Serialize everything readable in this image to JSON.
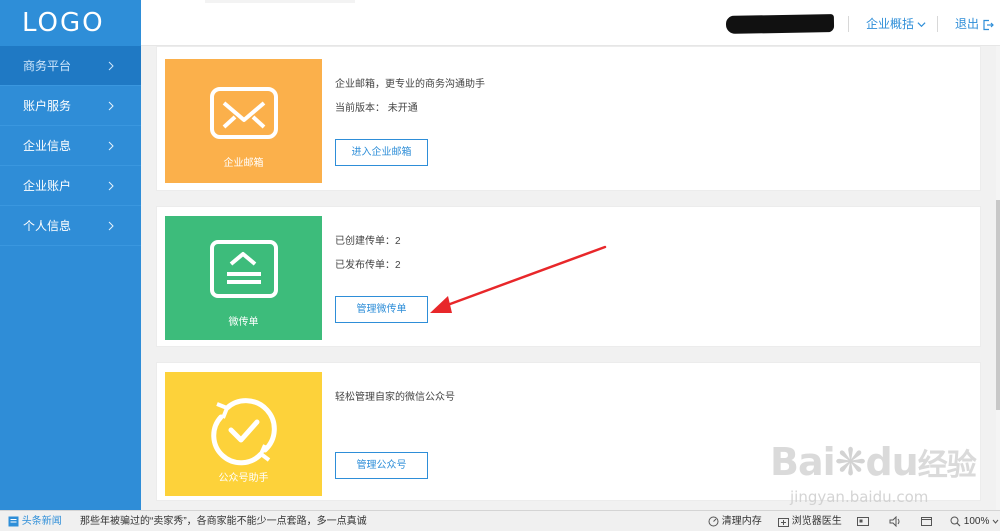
{
  "header": {
    "logo": "LOGO",
    "overview_label": "企业概括",
    "logout_label": "退出"
  },
  "sidebar": {
    "items": [
      {
        "label": "商务平台",
        "active": true
      },
      {
        "label": "账户服务"
      },
      {
        "label": "企业信息"
      },
      {
        "label": "企业账户"
      },
      {
        "label": "个人信息"
      }
    ]
  },
  "cards": [
    {
      "tile_label": "企业邮箱",
      "tile_color": "#fbb04b",
      "icon": "envelope-icon",
      "lines": [
        "企业邮箱，更专业的商务沟通助手",
        "当前版本： 未开通"
      ],
      "button": "进入企业邮箱"
    },
    {
      "tile_label": "微传单",
      "tile_color": "#3dbc7b",
      "icon": "flyer-icon",
      "lines": [
        "已创建传单：2",
        "已发布传单：2"
      ],
      "button": "管理微传单"
    },
    {
      "tile_label": "公众号助手",
      "tile_color": "#fdd23a",
      "icon": "check-circle-icon",
      "lines": [
        "轻松管理自家的微信公众号"
      ],
      "button": "管理公众号"
    }
  ],
  "watermark": {
    "logo": "Bai",
    "logo_tail": "du",
    "logo_cn": "经验",
    "url": "jingyan.baidu.com"
  },
  "statusbar": {
    "news_label": "头条新闻",
    "headline": "那些年被骗过的“卖家秀”，各商家能不能少一点套路，多一点真诚",
    "clean_memory": "清理内存",
    "browser_doctor": "浏览器医生",
    "zoom": "100%"
  },
  "colors": {
    "primary": "#2e8ed8",
    "sidebar_active": "#1f79c4",
    "arrow": "#e8272a"
  }
}
